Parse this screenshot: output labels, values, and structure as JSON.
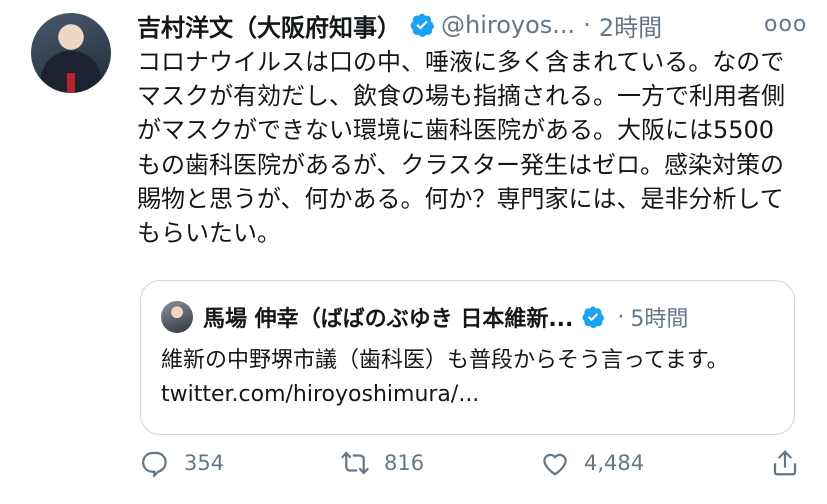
{
  "tweet": {
    "author_name": "吉村洋文（大阪府知事）",
    "handle": "@hiroyos...",
    "separator": "·",
    "time": "2時間",
    "more": "ooo",
    "text": "コロナウイルスは口の中、唾液に多く含まれている。なのでマスクが有効だし、飲食の場も指摘される。一方で利用者側がマスクができない環境に歯科医院がある。大阪には5500もの歯科医院があるが、クラスター発生はゼロ。感染対策の賜物と思うが、何かある。何か？専門家には、是非分析してもらいたい。"
  },
  "quote": {
    "author_name": "馬場 伸幸（ばばのぶゆき 日本維新...",
    "separator": "·",
    "time": "5時間",
    "text": "維新の中野堺市議（歯科医）も普段からそう言ってます。 twitter.com/hiroyoshimura/..."
  },
  "actions": {
    "reply_count": "354",
    "retweet_count": "816",
    "like_count": "4,484"
  },
  "colors": {
    "verified": "#1da1f2",
    "muted": "#657786",
    "border": "#ccd6dd",
    "text": "#14171a"
  },
  "icons": [
    "verified-badge-icon",
    "reply-icon",
    "retweet-icon",
    "like-icon",
    "share-icon",
    "more-icon"
  ]
}
